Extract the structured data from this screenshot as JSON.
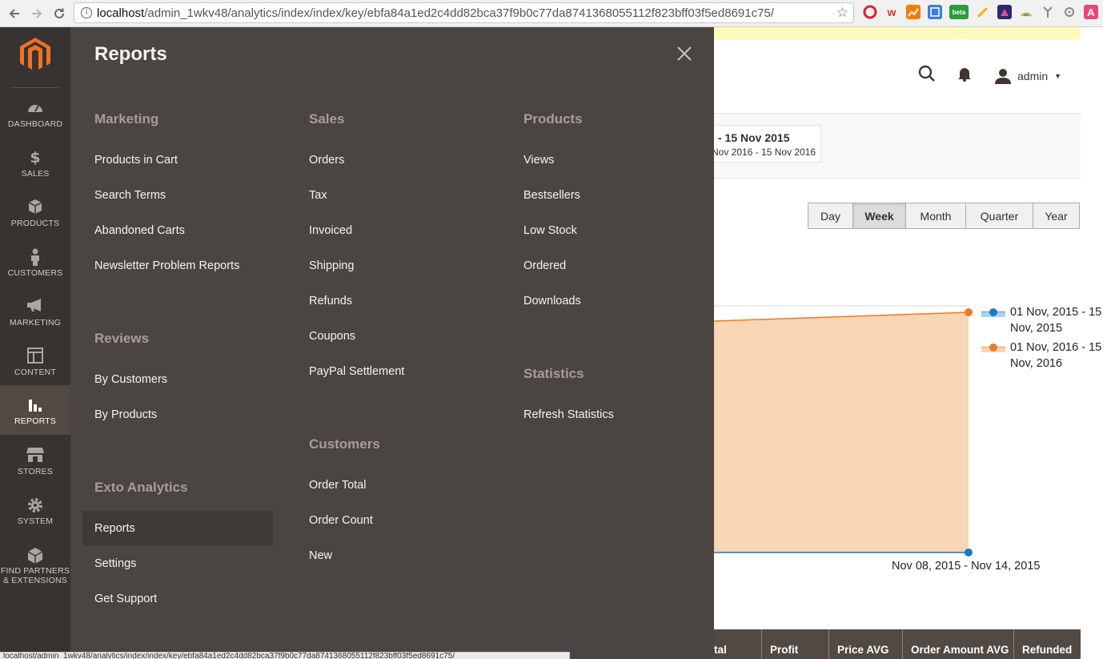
{
  "browser": {
    "url_host": "localhost",
    "url_path": "/admin_1wkv48/analytics/index/index/key/ebfa84a1ed2c4dd82bca37f9b0c77da8741368055112f823bff03f5ed8691c75/",
    "status_text": "localhost/admin_1wkv48/analytics/index/index/key/ebfa84a1ed2c4dd82bca37f9b0c77da8741368055112f823bff03f5ed8691c75/",
    "ext_beta_label": "beta",
    "ext_a_label": "A"
  },
  "sidebar": {
    "items": [
      {
        "label": "DASHBOARD",
        "icon": "dashboard-icon"
      },
      {
        "label": "SALES",
        "icon": "dollar-icon"
      },
      {
        "label": "PRODUCTS",
        "icon": "cube-icon"
      },
      {
        "label": "CUSTOMERS",
        "icon": "person-icon"
      },
      {
        "label": "MARKETING",
        "icon": "megaphone-icon"
      },
      {
        "label": "CONTENT",
        "icon": "layout-icon"
      },
      {
        "label": "REPORTS",
        "icon": "bar-chart-icon"
      },
      {
        "label": "STORES",
        "icon": "store-icon"
      },
      {
        "label": "SYSTEM",
        "icon": "gear-icon"
      },
      {
        "label": "FIND PARTNERS",
        "label2": "& EXTENSIONS",
        "icon": "box-icon"
      }
    ]
  },
  "header": {
    "user": "admin"
  },
  "date_range": {
    "main": "- 15 Nov 2015",
    "compare": "Nov 2016 - 15 Nov 2016"
  },
  "periods": [
    "Day",
    "Week",
    "Month",
    "Quarter",
    "Year"
  ],
  "selected_period": "Week",
  "chart": {
    "legend": [
      {
        "line1": "01 Nov, 2015 - 15",
        "line2": "Nov, 2015",
        "color": "#1979c3"
      },
      {
        "line1": "01 Nov, 2016 - 15",
        "line2": "Nov, 2016",
        "color": "#eb7c23"
      }
    ],
    "x_label": "Nov 08, 2015 - Nov 14, 2015"
  },
  "table_headers": [
    "tal",
    "Profit",
    "Price AVG",
    "Order Amount AVG",
    "Refunded"
  ],
  "reports_menu": {
    "title": "Reports",
    "marketing": {
      "title": "Marketing",
      "items": [
        "Products in Cart",
        "Search Terms",
        "Abandoned Carts",
        "Newsletter Problem Reports"
      ]
    },
    "reviews": {
      "title": "Reviews",
      "items": [
        "By Customers",
        "By Products"
      ]
    },
    "exto": {
      "title": "Exto Analytics",
      "items": [
        "Reports",
        "Settings",
        "Get Support"
      ]
    },
    "sales": {
      "title": "Sales",
      "items": [
        "Orders",
        "Tax",
        "Invoiced",
        "Shipping",
        "Refunds",
        "Coupons",
        "PayPal Settlement"
      ]
    },
    "customers": {
      "title": "Customers",
      "items": [
        "Order Total",
        "Order Count",
        "New"
      ]
    },
    "products": {
      "title": "Products",
      "items": [
        "Views",
        "Bestsellers",
        "Low Stock",
        "Ordered",
        "Downloads"
      ]
    },
    "statistics": {
      "title": "Statistics",
      "items": [
        "Refresh Statistics"
      ]
    }
  }
}
